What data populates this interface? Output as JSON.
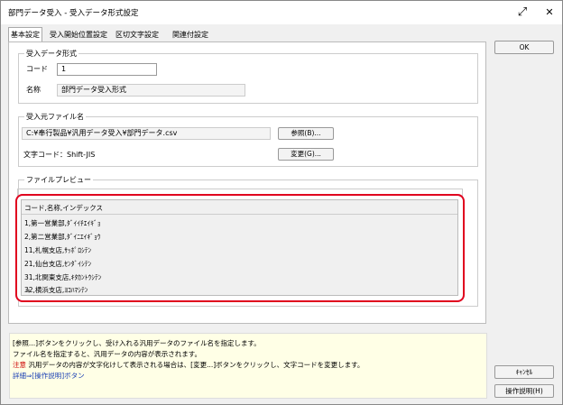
{
  "window": {
    "title": "部門データ受入 - 受入データ形式設定",
    "expand_icon": "⤢",
    "close_icon": "✕"
  },
  "tabs": [
    {
      "label": "基本設定",
      "active": true
    },
    {
      "label": "受入開始位置設定",
      "active": false
    },
    {
      "label": "区切文字設定",
      "active": false
    },
    {
      "label": "関連付設定",
      "active": false
    }
  ],
  "format_group": {
    "title": "受入データ形式",
    "code_label": "コード",
    "code_value": "1",
    "name_label": "名称",
    "name_value": "部門データ受入形式"
  },
  "source_group": {
    "title": "受入元ファイル名",
    "path_value": "C:¥奉行製品¥汎用データ受入¥部門データ.csv",
    "browse_button": "参照(B)...",
    "charset_label": "文字コード：Shift-JIS",
    "change_button": "変更(G)..."
  },
  "preview": {
    "title": "ファイルプレビュー",
    "rows": [
      "コード,名称,インデックス",
      "1,第一営業部,ﾀﾞｲｲﾁｴｲｷﾞｮ",
      "2,第二営業部,ﾀﾞｲﾆｴｲｷﾞｮｳ",
      "11,札幌支店,ｻｯﾎﾟﾛｼﾃﾝ",
      "21,仙台支店,ｾﾝﾀﾞｲｼﾃﾝ",
      "31,北関東支店,ｷﾀｶﾝﾄｳｼﾃﾝ",
      "32,横浜支店,ﾖｺﾊﾏｼﾃﾝ"
    ],
    "scroll_left_icon": "◀"
  },
  "buttons": {
    "ok": "OK",
    "cancel": "ｷｬﾝｾﾙ",
    "help": "操作説明(H)"
  },
  "help_text": {
    "line1": "[参照...]ボタンをクリックし、受け入れる汎用データのファイル名を指定します。",
    "line2": "ファイル名を指定すると、汎用データの内容が表示されます。",
    "note_label": "注意",
    "line3": "汎用データの内容が文字化けして表示される場合は、[変更...]ボタンをクリックし、文字コードを変更します。",
    "detail_link": "詳細⇒[操作説明]",
    "detail_suffix": "ボタン"
  }
}
